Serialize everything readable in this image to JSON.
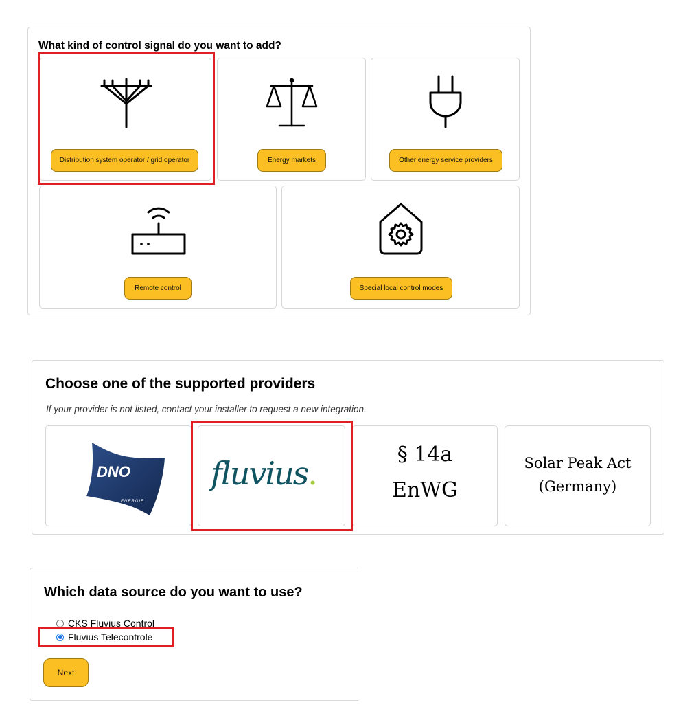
{
  "signal_panel": {
    "title": "What kind of control signal do you want to add?",
    "options": [
      {
        "icon": "power-pole-icon",
        "label": "Distribution system operator / grid operator"
      },
      {
        "icon": "scales-icon",
        "label": "Energy markets"
      },
      {
        "icon": "plug-icon",
        "label": "Other energy service providers"
      },
      {
        "icon": "router-icon",
        "label": "Remote control"
      },
      {
        "icon": "house-gear-icon",
        "label": "Special local control modes"
      }
    ]
  },
  "provider_panel": {
    "title": "Choose one of the supported providers",
    "subtitle": "If your provider is not listed, contact your installer to request a new integration.",
    "providers": [
      {
        "name": "DNO Energie",
        "logo_main": "DNO",
        "logo_sub": "ENERGIE"
      },
      {
        "name": "Fluvius",
        "logo_text": "fluvius",
        "logo_dot": "."
      },
      {
        "name": "§14a EnWG",
        "line1": "§ 14a",
        "line2": "EnWG"
      },
      {
        "name": "Solar Peak Act (Germany)",
        "line1": "Solar Peak Act",
        "line2": "(Germany)"
      }
    ]
  },
  "source_panel": {
    "title": "Which data source do you want to use?",
    "options": [
      {
        "label": "CKS Fluvius Control",
        "selected": false
      },
      {
        "label": "Fluvius Telecontrole",
        "selected": true
      }
    ],
    "next_label": "Next"
  },
  "colors": {
    "accent": "#fbbf24",
    "highlight": "#e01e26",
    "dno_blue": "#1e3a6b",
    "fluvius_teal": "#0f5460",
    "fluvius_green": "#a4c93a"
  }
}
